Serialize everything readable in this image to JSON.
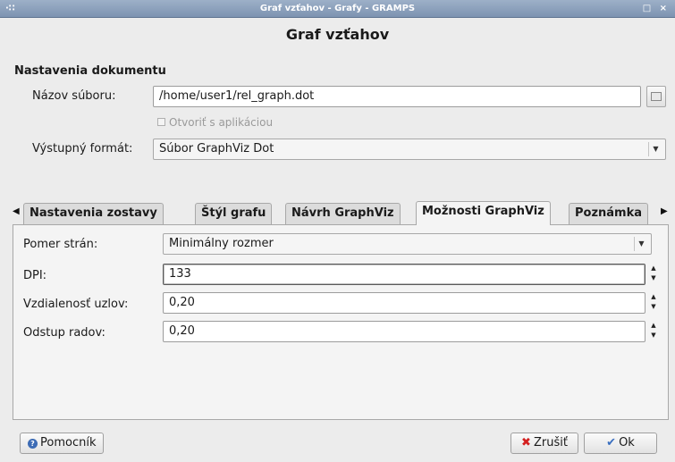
{
  "window": {
    "title": "Graf vzťahov - Grafy - GRAMPS",
    "menu_glyph": "·∷",
    "controls_glyph": "□ ×"
  },
  "dialog": {
    "title": "Graf vzťahov"
  },
  "document_settings": {
    "heading": "Nastavenia dokumentu",
    "filename_label": "Názov súboru:",
    "filename_value": "/home/user1/rel_graph.dot",
    "open_with_app_label": "Otvoriť s aplikáciou",
    "open_with_app_checked": false,
    "open_with_app_enabled": false,
    "output_format_label": "Výstupný formát:",
    "output_format_value": "Súbor GraphViz Dot"
  },
  "tabs": {
    "scroll_left": "◀",
    "scroll_right": "▶",
    "items": [
      {
        "label": "Nastavenia zostavy",
        "active": false
      },
      {
        "label": "Štýl grafu",
        "active": false
      },
      {
        "label": "Návrh GraphViz",
        "active": false
      },
      {
        "label": "Možnosti GraphViz",
        "active": true
      },
      {
        "label": "Poznámka",
        "active": false
      }
    ]
  },
  "graphviz_options": {
    "aspect_label": "Pomer strán:",
    "aspect_value": "Minimálny rozmer",
    "dpi_label": "DPI:",
    "dpi_value": "133",
    "node_spacing_label": "Vzdialenosť uzlov:",
    "node_spacing_value": "0,20",
    "rank_spacing_label": "Odstup radov:",
    "rank_spacing_value": "0,20"
  },
  "buttons": {
    "help_label": "Pomocník",
    "cancel_label": "Zrušiť",
    "ok_label": "Ok"
  },
  "icons": {
    "help": "help-icon",
    "cancel": "cancel-x-icon",
    "ok": "ok-checkmark-icon",
    "file_chooser": "folder-icon",
    "dropdown": "chevron-down-icon",
    "spin": "spin-arrows-icon"
  }
}
